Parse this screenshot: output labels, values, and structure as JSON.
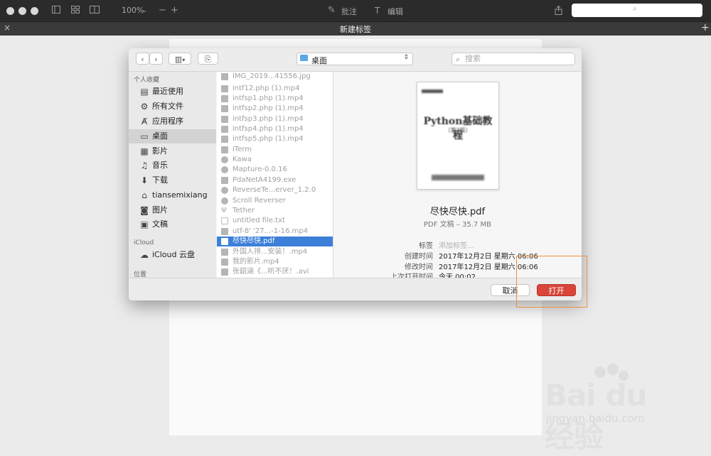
{
  "titlebar": {
    "zoom": "100%",
    "annotate_label": "批注",
    "edit_label": "编辑"
  },
  "tab": {
    "title": "新建标签"
  },
  "dialog": {
    "location": "桌面",
    "search_placeholder": "搜索",
    "sidebar": {
      "favorites_header": "个人收藏",
      "items": [
        {
          "label": "最近使用",
          "icon": "recent-icon"
        },
        {
          "label": "所有文件",
          "icon": "gear-icon"
        },
        {
          "label": "应用程序",
          "icon": "applications-icon"
        },
        {
          "label": "桌面",
          "icon": "desktop-icon"
        },
        {
          "label": "影片",
          "icon": "movies-icon"
        },
        {
          "label": "音乐",
          "icon": "music-icon"
        },
        {
          "label": "下载",
          "icon": "download-icon"
        },
        {
          "label": "tiansemixiang",
          "icon": "home-icon"
        },
        {
          "label": "图片",
          "icon": "camera-icon"
        },
        {
          "label": "文稿",
          "icon": "document-icon"
        }
      ],
      "icloud_header": "iCloud",
      "icloud_item": "iCloud 云盘",
      "locations_header": "位置"
    },
    "files": [
      "IMG_2019...41556.jpg",
      "intf12.php (1).mp4",
      "intfsp1.php (1).mp4",
      "intfsp2.php (1).mp4",
      "intfsp3.php (1).mp4",
      "intfsp4.php (1).mp4",
      "intfsp5.php (1).mp4",
      "iTerm",
      "Kawa",
      "Mapture-0.0.16",
      "PdaNetA4199.exe",
      "ReverseTe...erver_1.2.0",
      "Scroll Reverser",
      "Tether",
      "untitled file.txt",
      "utf-8' '27...-1-16.mp4",
      "尽快尽快.pdf",
      "外国人排...安装！.mp4",
      "我的影片.mp4",
      "张韶涵《...听不厌！.avi"
    ],
    "selected_file": "尽快尽快.pdf",
    "preview": {
      "thumb_title": "Python基础教程",
      "thumb_edition": "（第3版）",
      "name": "尽快尽快.pdf",
      "meta": "PDF 文稿 – 35.7 MB",
      "info": [
        {
          "key": "标签",
          "value": "添加标签…"
        },
        {
          "key": "创建时间",
          "value": "2017年12月2日 星期六 06:06"
        },
        {
          "key": "修改时间",
          "value": "2017年12月2日 星期六 06:06"
        },
        {
          "key": "上次打开时间",
          "value": "今天 00:02"
        }
      ]
    },
    "cancel_label": "取消",
    "open_label": "打开"
  },
  "watermark": {
    "brand": "Bai du 经验",
    "url": "jingyan.baidu.com"
  },
  "colors": {
    "accent": "#3b7fd9",
    "open_button": "#d9453a",
    "highlight": "#ef8e3a"
  }
}
